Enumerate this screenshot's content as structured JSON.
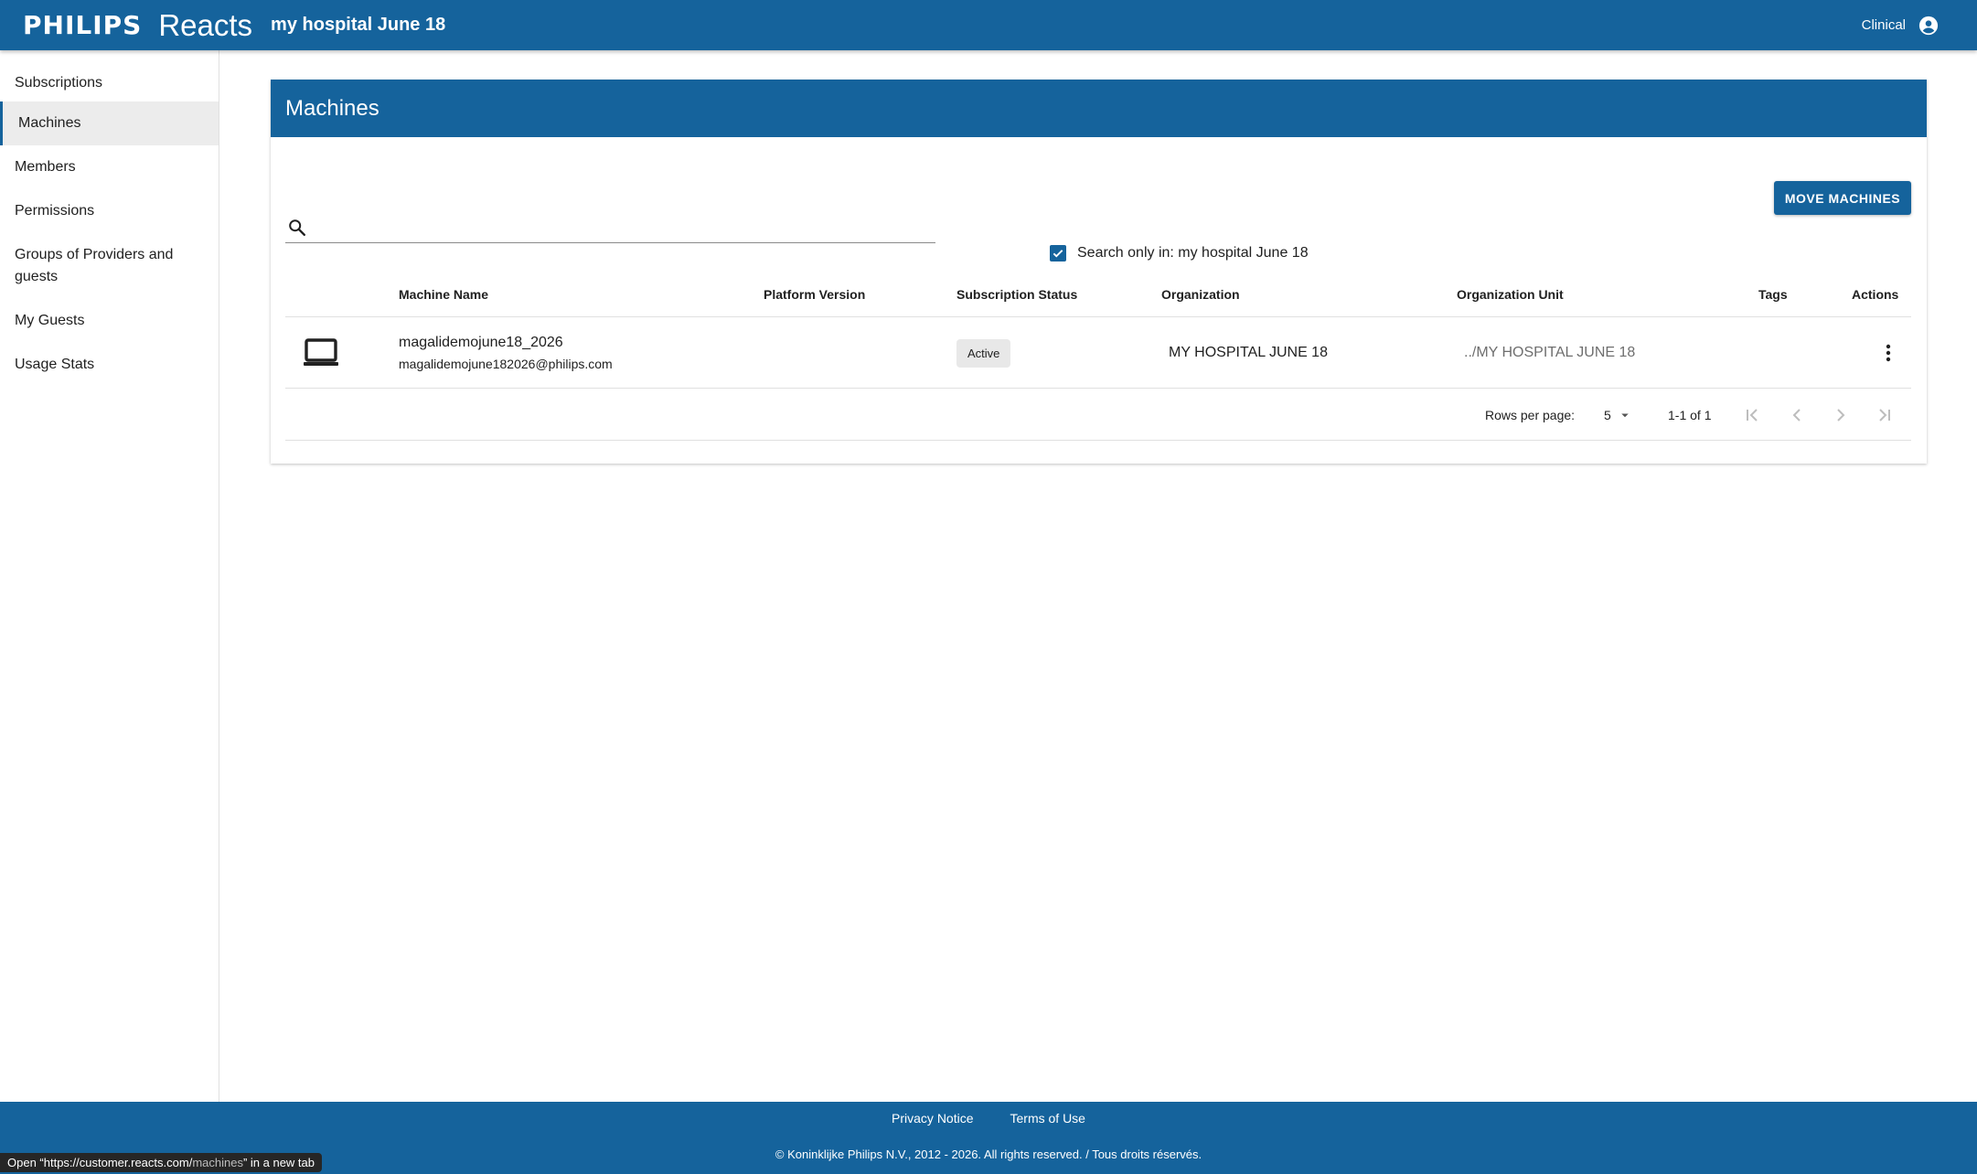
{
  "header": {
    "brand": "PHILIPS",
    "product": "Reacts",
    "org_name": "my hospital June 18",
    "role": "Clinical",
    "user_icon": "account-circle-icon"
  },
  "sidebar": {
    "items": [
      {
        "label": "Subscriptions"
      },
      {
        "label": "Machines",
        "active": true
      },
      {
        "label": "Members"
      },
      {
        "label": "Permissions"
      },
      {
        "label": "Groups of Providers and guests"
      },
      {
        "label": "My Guests"
      },
      {
        "label": "Usage Stats"
      }
    ]
  },
  "main": {
    "title": "Machines",
    "move_button": "MOVE MACHINES",
    "search": {
      "value": "",
      "placeholder": ""
    },
    "filter": {
      "checked": true,
      "label": "Search only in: my hospital June 18"
    },
    "columns": [
      "Machine Name",
      "Platform Version",
      "Subscription Status",
      "Organization",
      "Organization Unit",
      "Tags",
      "Actions"
    ],
    "rows": [
      {
        "icon": "laptop-icon",
        "machine_name": "magalidemojune18_2026",
        "email": "magalidemojune182026@philips.com",
        "platform_version": "",
        "status": "Active",
        "organization": "MY HOSPITAL JUNE 18",
        "organization_unit": "../MY HOSPITAL JUNE 18",
        "tags": ""
      }
    ],
    "pagination": {
      "rows_per_page_label": "Rows per page:",
      "rows_per_page": "5",
      "range": "1-1 of 1"
    }
  },
  "footer": {
    "privacy": "Privacy Notice",
    "terms": "Terms of Use",
    "copyright": "© Koninklijke Philips N.V., 2012 - 2026. All rights reserved. / Tous droits réservés."
  },
  "statusbar": {
    "prefix": "Open “https://customer.reacts.com/",
    "path": "machines",
    "suffix": "” in a new tab"
  },
  "colors": {
    "primary": "#15639c",
    "active_nav": "#ececec",
    "badge": "#e8e8e8"
  }
}
